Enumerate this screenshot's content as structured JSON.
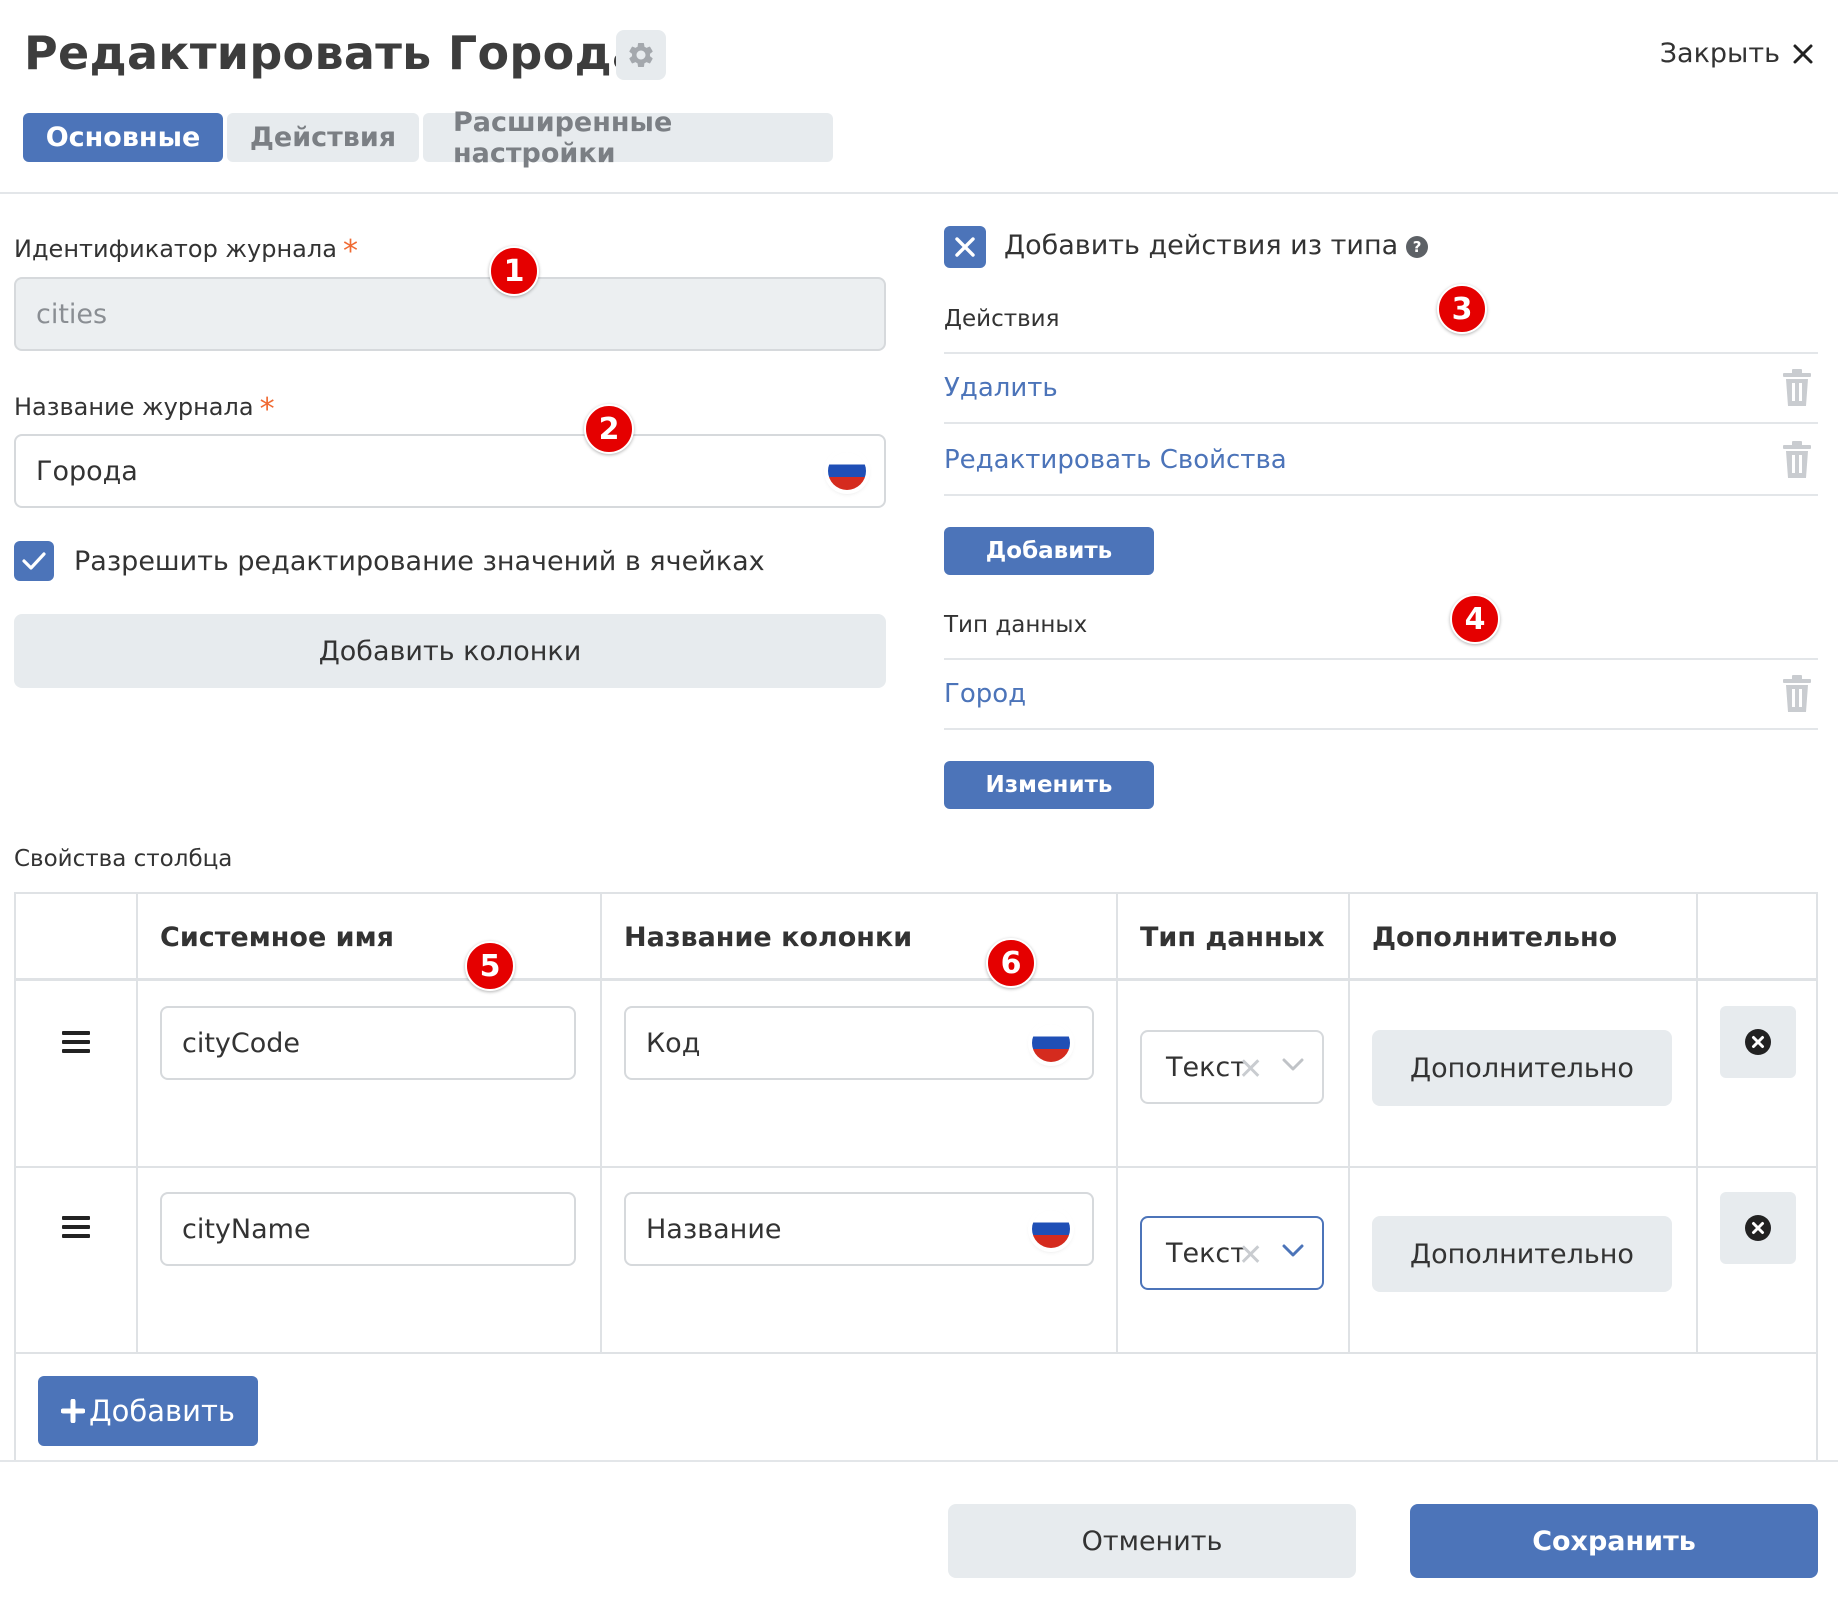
{
  "header": {
    "title": "Редактировать Города",
    "close_label": "Закрыть"
  },
  "tabs": [
    {
      "label": "Основные",
      "active": true
    },
    {
      "label": "Действия",
      "active": false
    },
    {
      "label": "Расширенные настройки",
      "active": false
    }
  ],
  "form": {
    "journal_id_label": "Идентификатор журнала",
    "journal_id_value": "cities",
    "journal_name_label": "Название журнала",
    "journal_name_value": "Города",
    "required_mark": "*",
    "allow_edit_label": "Разрешить редактирование значений в ячейках",
    "allow_edit_checked": true,
    "add_columns_label": "Добавить колонки"
  },
  "actions_panel": {
    "add_from_type_label": "Добавить действия из типа",
    "help_glyph": "?",
    "actions_heading": "Действия",
    "actions": [
      "Удалить",
      "Редактировать Свойства"
    ],
    "add_button": "Добавить",
    "data_type_heading": "Тип данных",
    "data_types": [
      "Город"
    ],
    "change_button": "Изменить"
  },
  "columns_section": {
    "title": "Свойства столбца",
    "headers": [
      "Системное имя",
      "Название колонки",
      "Тип данных",
      "Дополнительно"
    ],
    "rows": [
      {
        "system_name": "cityCode",
        "column_name": "Код",
        "data_type": "Текст",
        "extra_button": "Дополнительно"
      },
      {
        "system_name": "cityName",
        "column_name": "Название",
        "data_type": "Текст",
        "extra_button": "Дополнительно"
      }
    ],
    "add_button": "Добавить"
  },
  "footer": {
    "cancel": "Отменить",
    "save": "Сохранить"
  },
  "annotations": [
    "1",
    "2",
    "3",
    "4",
    "5",
    "6"
  ],
  "colors": {
    "accent": "#4c74b9",
    "badge": "#e50000",
    "required": "#f06a32"
  }
}
